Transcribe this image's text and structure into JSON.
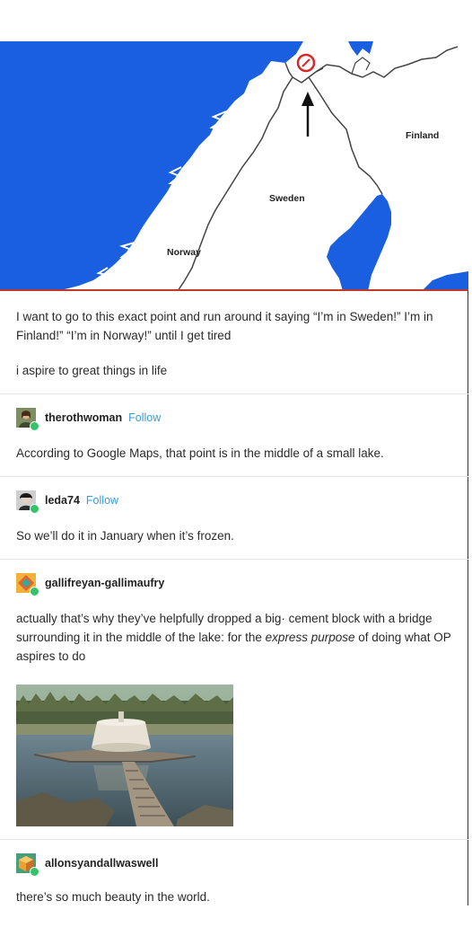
{
  "map": {
    "labels": {
      "finland": "Finland",
      "sweden": "Sweden",
      "norway": "Norway"
    },
    "colors": {
      "sea": "#1a5fe0",
      "land": "#ffffff",
      "border": "#444444",
      "marker": "#d62828"
    }
  },
  "op": {
    "text1": "I want to go to this exact point and run around it saying “I’m in Sweden!” I’m in Finland!” “I’m in Norway!” until I get tired",
    "text2": "i aspire to great things in life"
  },
  "replies": [
    {
      "username": "therothwoman",
      "follow": "Follow",
      "text": "According to Google Maps, that point is in the middle of a small lake."
    },
    {
      "username": "leda74",
      "follow": "Follow",
      "text": "So we’ll do it in January when it’s frozen."
    },
    {
      "username": "gallifreyan-gallimaufry",
      "text_a": "actually that’s why they’ve helpfully dropped a big·      cement block with a bridge surrounding it in the middle of the lake: for the ",
      "text_em1": "express purpose",
      "text_b": " of doing what OP aspires to do"
    },
    {
      "username": "allonsyandallwaswell",
      "text": "there’s so much beauty in the world."
    }
  ],
  "icons": {
    "avatar1": "person-avatar-icon",
    "avatar2": "person-avatar-icon",
    "avatar3": "diamond-avatar-icon",
    "avatar4": "cube-avatar-icon",
    "arrow": "arrow-up-icon",
    "marker": "circled-point-icon"
  }
}
